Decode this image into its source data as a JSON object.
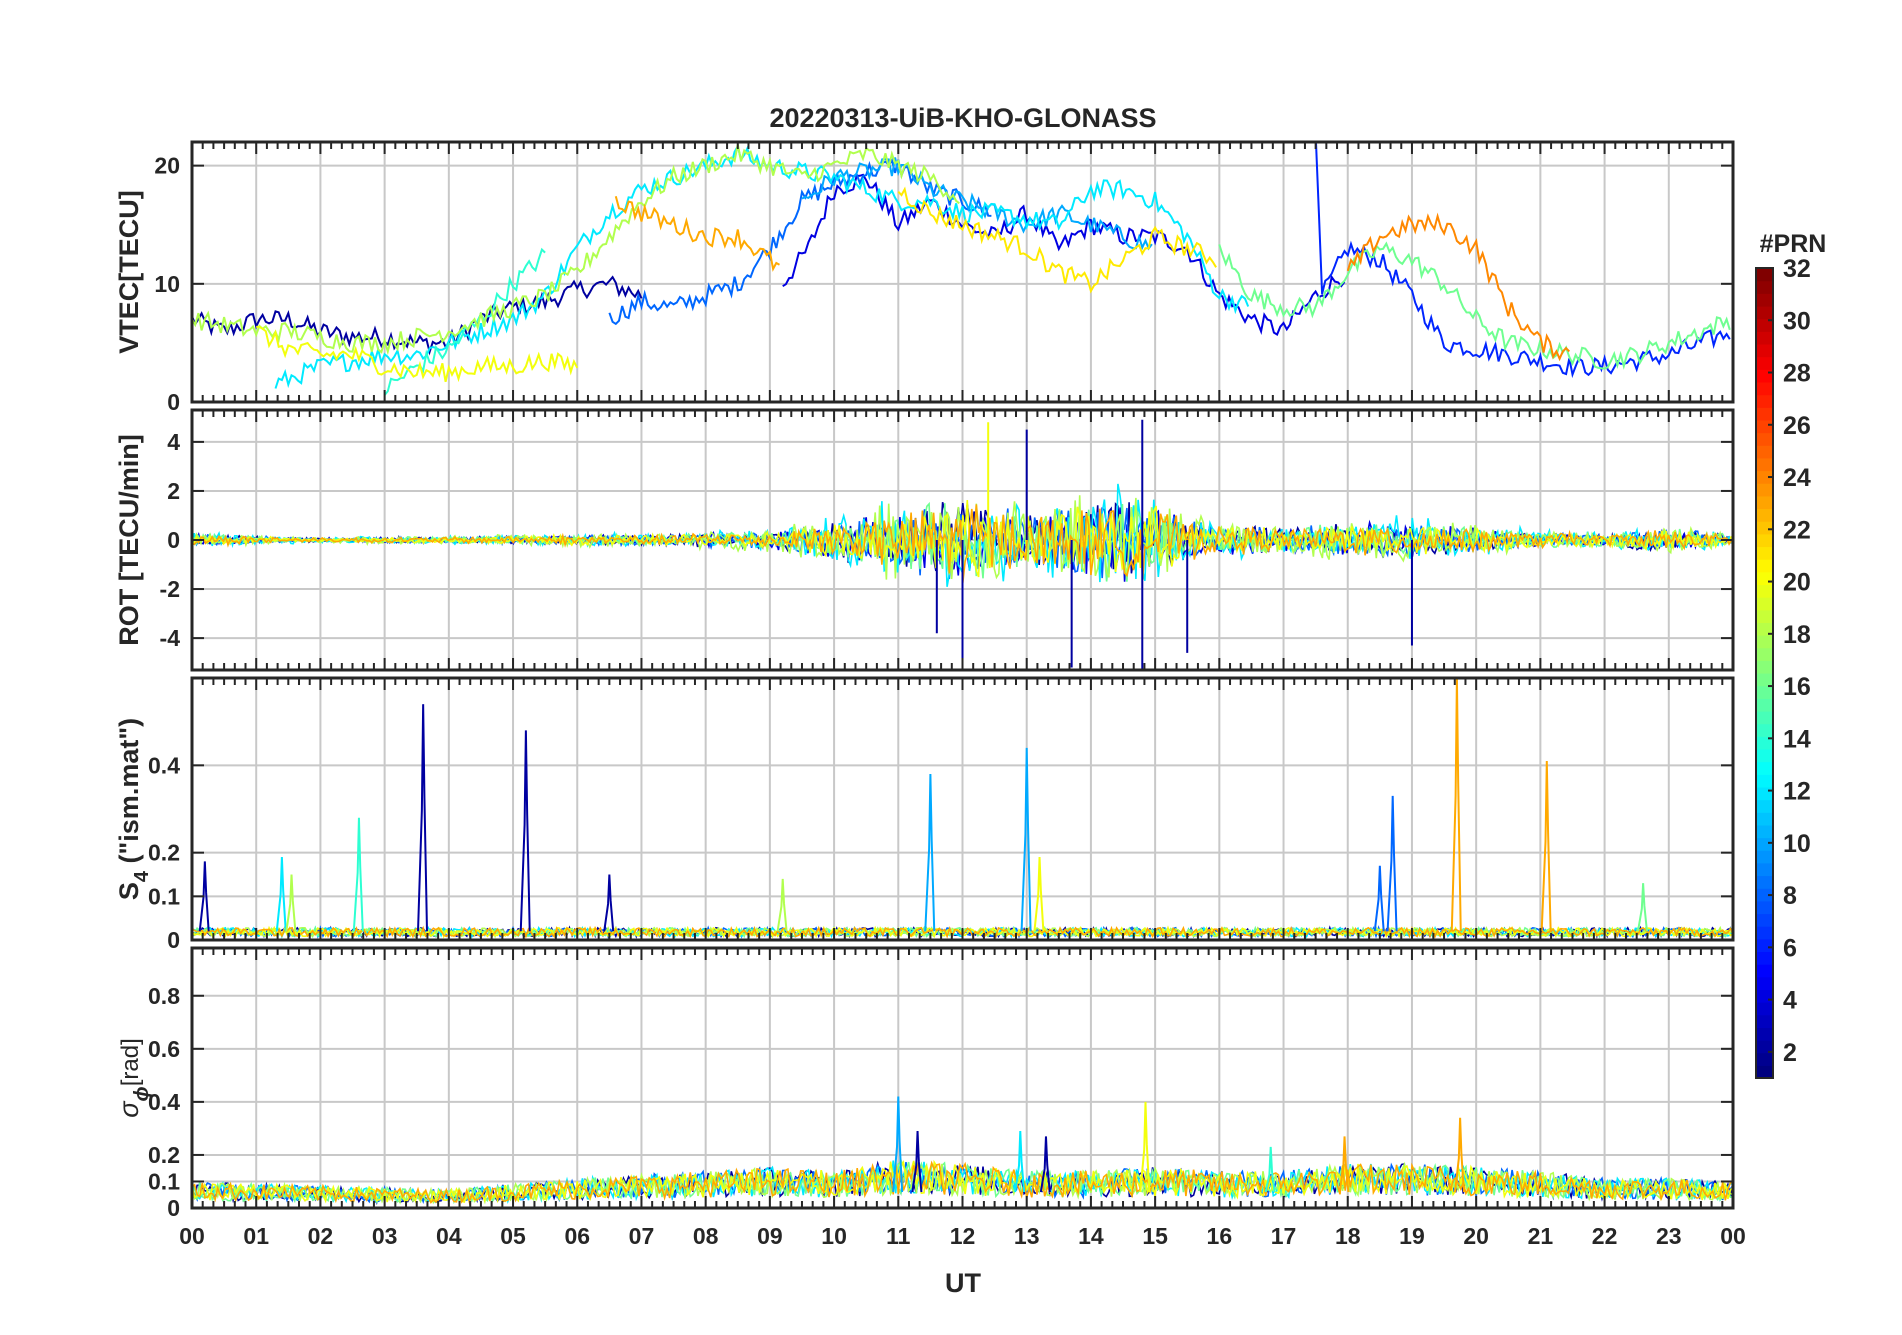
{
  "chart_data": {
    "type": "line",
    "title": "20220313-UiB-KHO-GLONASS",
    "xlabel": "UT",
    "x_tick_labels": [
      "00",
      "01",
      "02",
      "03",
      "04",
      "05",
      "06",
      "07",
      "08",
      "09",
      "10",
      "11",
      "12",
      "13",
      "14",
      "15",
      "16",
      "17",
      "18",
      "19",
      "20",
      "21",
      "22",
      "23",
      "00"
    ],
    "xlim": [
      0,
      24
    ],
    "grid": true,
    "colormap": "jet",
    "colorbar": {
      "title": "#PRN",
      "range": [
        1,
        32
      ],
      "tick_labels": [
        "2",
        "4",
        "6",
        "8",
        "10",
        "12",
        "14",
        "16",
        "18",
        "20",
        "22",
        "24",
        "26",
        "28",
        "30",
        "32"
      ],
      "colors": [
        "#00008f",
        "#0000ff",
        "#0080ff",
        "#00ffff",
        "#80ff80",
        "#ffff00",
        "#ff8000",
        "#ff0000",
        "#800000"
      ]
    },
    "panels": [
      {
        "ylabel": "VTEC[TECU]",
        "ylim": [
          0,
          22
        ],
        "y_ticks": [
          0,
          10,
          20
        ],
        "y_tick_labels": [
          "0",
          "10",
          "20"
        ],
        "series": [
          {
            "prn": 2,
            "x": [
              0,
              0.5,
              1,
              1.5,
              2,
              2.5,
              3,
              3.5,
              4,
              4.5,
              5,
              5.5,
              6,
              6.5,
              7
            ],
            "y": [
              7,
              6,
              7,
              7,
              6,
              5.5,
              5.5,
              5,
              5,
              7,
              8,
              8.5,
              9.5,
              10,
              9
            ]
          },
          {
            "prn": 4,
            "x": [
              9.2,
              9.6,
              10,
              10.5,
              11,
              11.5,
              12,
              12.5,
              13,
              13.5,
              14,
              14.5,
              15,
              15.5,
              16,
              16.5,
              17,
              17.5,
              18
            ],
            "y": [
              10,
              13,
              18,
              19,
              15,
              17,
              15,
              14,
              16,
              13,
              15,
              14,
              14,
              13,
              9,
              7,
              6,
              9,
              11
            ]
          },
          {
            "prn": 6,
            "x": [
              17.5,
              17.6,
              18,
              18.5,
              19,
              19.5,
              20,
              20.5,
              21,
              21.5,
              22,
              22.5,
              23,
              23.5,
              24
            ],
            "y": [
              22,
              9,
              13,
              12,
              9,
              5,
              4.5,
              4,
              3.5,
              3,
              3,
              3.5,
              4,
              5,
              6
            ]
          },
          {
            "prn": 8,
            "x": [
              6.5,
              7,
              7.5,
              8,
              8.5,
              9,
              9.5,
              10,
              10.5,
              11,
              11.5,
              12,
              12.5
            ],
            "y": [
              7,
              8.5,
              8,
              9,
              10,
              13,
              17,
              18.5,
              19.5,
              20,
              18,
              17,
              16
            ]
          },
          {
            "prn": 10,
            "x": [
              9.5,
              10,
              10.5,
              11,
              11.5,
              12,
              12.5,
              13,
              13.5,
              14,
              14.5,
              15
            ],
            "y": [
              17,
              19,
              19.5,
              20,
              18,
              17,
              16,
              15,
              16,
              15,
              14,
              13
            ]
          },
          {
            "prn": 12,
            "x": [
              1.3,
              2,
              2.5,
              3,
              3.5,
              4,
              4.5,
              5,
              5.5,
              6,
              6.5,
              7,
              7.5,
              8,
              8.5,
              9,
              9.5,
              10,
              10.5,
              11,
              11.5,
              12,
              12.5,
              13,
              13.5,
              14,
              14.5,
              15,
              15.5,
              16,
              16.5
            ],
            "y": [
              1.5,
              3,
              3.5,
              4,
              4,
              5,
              6,
              7,
              9,
              13,
              16,
              18,
              19,
              20,
              21,
              20,
              19.5,
              19,
              18,
              17,
              17,
              16,
              16,
              15.5,
              15,
              18,
              18,
              17,
              14,
              9,
              8
            ]
          },
          {
            "prn": 14,
            "x": [
              3,
              3.5,
              4,
              4.5,
              5,
              5.5
            ],
            "y": [
              1,
              3,
              4.5,
              7,
              10,
              12.5
            ]
          },
          {
            "prn": 16,
            "x": [
              16,
              16.5,
              17,
              17.5,
              18,
              18.5,
              19,
              19.5,
              20,
              20.5,
              21,
              21.5,
              22,
              22.5,
              23,
              23.5,
              24
            ],
            "y": [
              13,
              9,
              8,
              8,
              11,
              13,
              12,
              10,
              7,
              5,
              4.5,
              4,
              3.5,
              4,
              5,
              6,
              7
            ]
          },
          {
            "prn": 18,
            "x": [
              0,
              0.5,
              1,
              1.5,
              2,
              2.5,
              3,
              3.5,
              4,
              4.5,
              5,
              5.5,
              6,
              6.5,
              7,
              7.5,
              8,
              8.5,
              9,
              9.5,
              10,
              10.5,
              11,
              11.5,
              12
            ],
            "y": [
              7,
              6.5,
              6,
              6,
              5.5,
              5,
              5,
              5.5,
              6,
              7,
              8,
              9,
              11,
              14,
              17,
              19,
              20,
              21,
              20,
              19,
              20,
              21,
              20,
              19,
              17
            ]
          },
          {
            "prn": 20,
            "x": [
              1,
              1.5,
              2,
              2.5,
              3,
              3.5,
              4,
              4.5,
              5,
              5.5,
              6
            ],
            "y": [
              6,
              4.5,
              4,
              4,
              3,
              2.5,
              2.5,
              3,
              3,
              3.5,
              3
            ]
          },
          {
            "prn": 21,
            "x": [
              11,
              11.5,
              12,
              12.5,
              13,
              13.5,
              14,
              14.5,
              15,
              15.5,
              16
            ],
            "y": [
              18,
              16,
              15,
              14,
              13,
              11,
              10,
              12,
              14,
              13,
              12
            ]
          },
          {
            "prn": 23,
            "x": [
              6.6,
              7,
              7.5,
              8,
              8.5,
              9,
              9.2
            ],
            "y": [
              17,
              16,
              15,
              14,
              14,
              12,
              11
            ]
          },
          {
            "prn": 24,
            "x": [
              18,
              18.5,
              19,
              19.5,
              20,
              20.5,
              21,
              21.5
            ],
            "y": [
              11,
              14,
              15,
              15,
              13,
              8,
              5,
              4
            ]
          }
        ]
      },
      {
        "ylabel": "ROT [TECU/min]",
        "ylim": [
          -5.3,
          5.3
        ],
        "y_ticks": [
          -4,
          -2,
          0,
          2,
          4
        ],
        "y_tick_labels": [
          "-4",
          "-2",
          "0",
          "2",
          "4"
        ],
        "activity": {
          "x": [
            0,
            1,
            2,
            3,
            4,
            5,
            6,
            7,
            8,
            9,
            9.5,
            10,
            10.5,
            11,
            11.5,
            12,
            12.5,
            13,
            13.5,
            14,
            14.5,
            15,
            15.5,
            16,
            17,
            18,
            19,
            20,
            21,
            22,
            23,
            24
          ],
          "amplitude": [
            0.6,
            0.4,
            0.2,
            0.3,
            0.3,
            0.4,
            0.5,
            0.5,
            0.7,
            0.9,
            1.3,
            1.8,
            2.5,
            3,
            3.5,
            4,
            3.5,
            3,
            3,
            3.5,
            4.5,
            3.5,
            2,
            1.5,
            1.2,
            1.6,
            1.8,
            1.2,
            0.8,
            0.6,
            1.2,
            0.6
          ]
        },
        "peaks": [
          {
            "x": 12.4,
            "y": 4.8
          },
          {
            "x": 13.0,
            "y": 4.5
          },
          {
            "x": 14.8,
            "y": 4.9
          },
          {
            "x": 12.0,
            "y": -5.2
          },
          {
            "x": 13.7,
            "y": -5.2
          },
          {
            "x": 14.8,
            "y": -5.3
          },
          {
            "x": 11.6,
            "y": -3.8
          },
          {
            "x": 15.5,
            "y": -4.6
          },
          {
            "x": 19.0,
            "y": -4.3
          }
        ]
      },
      {
        "ylabel_main": "S",
        "ylabel_sub": "4",
        "ylabel_rest": " (\"ism.mat\")",
        "ylim": [
          0,
          0.6
        ],
        "y_ticks": [
          0,
          0.1,
          0.2,
          0.4
        ],
        "y_tick_labels": [
          "0",
          "0.1",
          "0.2",
          "0.4"
        ],
        "baseline": 0.02,
        "spikes": [
          {
            "x": 0.2,
            "y": 0.18,
            "prn": 2
          },
          {
            "x": 1.4,
            "y": 0.19,
            "prn": 12
          },
          {
            "x": 1.55,
            "y": 0.15,
            "prn": 18
          },
          {
            "x": 2.6,
            "y": 0.28,
            "prn": 14
          },
          {
            "x": 3.6,
            "y": 0.54,
            "prn": 2
          },
          {
            "x": 5.2,
            "y": 0.48,
            "prn": 2
          },
          {
            "x": 6.5,
            "y": 0.15,
            "prn": 2
          },
          {
            "x": 9.2,
            "y": 0.14,
            "prn": 18
          },
          {
            "x": 11.5,
            "y": 0.38,
            "prn": 10
          },
          {
            "x": 13.0,
            "y": 0.44,
            "prn": 10
          },
          {
            "x": 13.2,
            "y": 0.19,
            "prn": 20
          },
          {
            "x": 18.5,
            "y": 0.17,
            "prn": 8
          },
          {
            "x": 18.7,
            "y": 0.33,
            "prn": 8
          },
          {
            "x": 19.7,
            "y": 0.6,
            "prn": 23
          },
          {
            "x": 21.1,
            "y": 0.41,
            "prn": 23
          },
          {
            "x": 22.6,
            "y": 0.13,
            "prn": 16
          }
        ]
      },
      {
        "ylabel_main": "σ",
        "ylabel_sub": "ϕ",
        "ylabel_rest": "[rad]",
        "ylim": [
          0,
          0.98
        ],
        "y_ticks": [
          0,
          0.1,
          0.2,
          0.4,
          0.6,
          0.8
        ],
        "y_tick_labels": [
          "0",
          "0.1",
          "0.2",
          "0.4",
          "0.6",
          "0.8"
        ],
        "baseline": 0.06,
        "activity_x": [
          0,
          2,
          4,
          6,
          8,
          9,
          10,
          11,
          12,
          13,
          14,
          15,
          16,
          17,
          18,
          19,
          20,
          21,
          22,
          23,
          24
        ],
        "activity_amp": [
          0.07,
          0.06,
          0.05,
          0.08,
          0.1,
          0.11,
          0.1,
          0.13,
          0.12,
          0.1,
          0.1,
          0.11,
          0.1,
          0.1,
          0.12,
          0.12,
          0.11,
          0.1,
          0.08,
          0.08,
          0.07
        ],
        "spikes": [
          {
            "x": 11.0,
            "y": 0.42,
            "prn": 10
          },
          {
            "x": 11.3,
            "y": 0.29,
            "prn": 2
          },
          {
            "x": 12.9,
            "y": 0.29,
            "prn": 12
          },
          {
            "x": 13.3,
            "y": 0.27,
            "prn": 2
          },
          {
            "x": 14.85,
            "y": 0.4,
            "prn": 20
          },
          {
            "x": 17.95,
            "y": 0.27,
            "prn": 23
          },
          {
            "x": 19.75,
            "y": 0.34,
            "prn": 23
          },
          {
            "x": 16.8,
            "y": 0.23,
            "prn": 14
          }
        ]
      }
    ]
  }
}
